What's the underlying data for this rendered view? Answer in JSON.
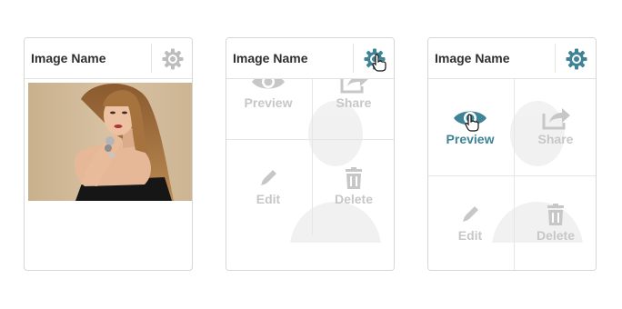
{
  "cards": [
    {
      "title": "Image Name",
      "state": "default",
      "gear_icon": "gear-icon",
      "image": "portrait-photo"
    },
    {
      "title": "Image Name",
      "state": "gear-hover",
      "gear_icon": "gear-icon",
      "actions": {
        "preview": "Preview",
        "share": "Share",
        "edit": "Edit",
        "delete": "Delete"
      }
    },
    {
      "title": "Image Name",
      "state": "preview-hover",
      "gear_icon": "gear-icon",
      "actions": {
        "preview": "Preview",
        "share": "Share",
        "edit": "Edit",
        "delete": "Delete"
      }
    }
  ],
  "colors": {
    "accent": "#3f8396",
    "inactive_icon": "#c7c7c7",
    "gear_idle": "#bdbdbd",
    "border": "#d6d6d6"
  }
}
